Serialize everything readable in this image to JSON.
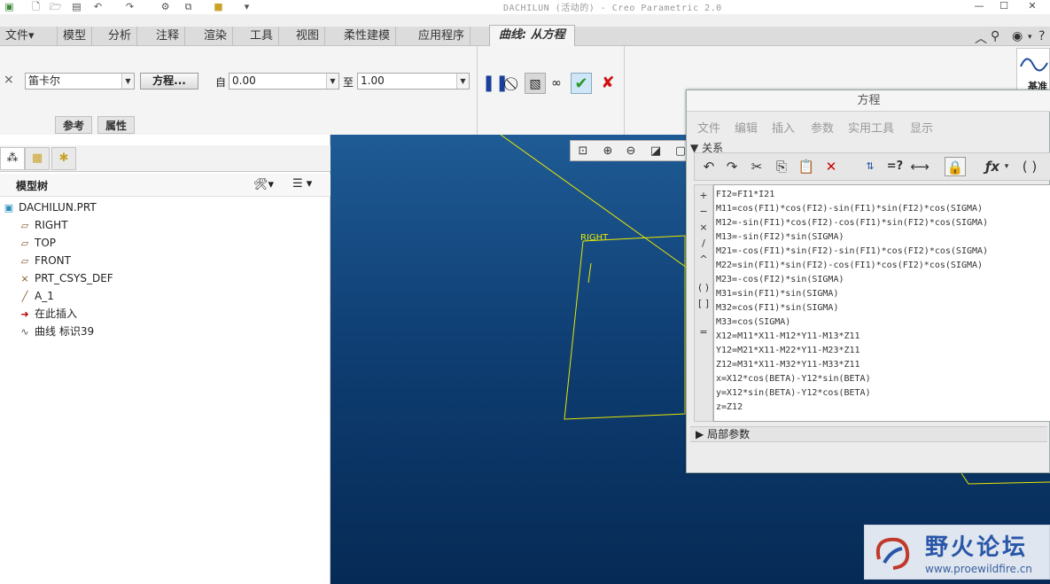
{
  "app": {
    "title": "DACHILUN (活动的) - Creo Parametric 2.0"
  },
  "menu": {
    "tabs": [
      "文件▾",
      "模型",
      "分析",
      "注释",
      "渲染",
      "工具",
      "视图",
      "柔性建模",
      "应用程序"
    ],
    "active_tab": "曲线: 从方程"
  },
  "ribbon": {
    "coord_system": "笛卡尔",
    "equation_button": "方程...",
    "from_label": "自",
    "from_value": "0.00",
    "to_label": "至",
    "to_value": "1.00",
    "subtabs": [
      "参考",
      "属性"
    ],
    "right_widget_label": "基准"
  },
  "model_tree": {
    "title": "模型树",
    "items": [
      {
        "icon": "part-icon",
        "label": "DACHILUN.PRT"
      },
      {
        "icon": "datum-plane-icon",
        "label": "RIGHT"
      },
      {
        "icon": "datum-plane-icon",
        "label": "TOP"
      },
      {
        "icon": "datum-plane-icon",
        "label": "FRONT"
      },
      {
        "icon": "csys-icon",
        "label": "PRT_CSYS_DEF"
      },
      {
        "icon": "axis-icon",
        "label": "A_1"
      },
      {
        "icon": "insert-arrow-icon",
        "label": "在此插入"
      },
      {
        "icon": "curve-icon",
        "label": "曲线 标识39"
      }
    ]
  },
  "graphics": {
    "plane_label": "RIGHT"
  },
  "equation_dialog": {
    "title": "方程",
    "menu": [
      "文件",
      "编辑",
      "插入",
      "参数",
      "实用工具",
      "显示"
    ],
    "section_relations": "关系",
    "operators": [
      "+",
      "−",
      "×",
      "/",
      "^",
      "( )",
      "[ ]",
      "="
    ],
    "equations": [
      "FI2=FI1*I21",
      "M11=cos(FI1)*cos(FI2)-sin(FI1)*sin(FI2)*cos(SIGMA)",
      "M12=-sin(FI1)*cos(FI2)-cos(FI1)*sin(FI2)*cos(SIGMA)",
      "M13=-sin(FI2)*sin(SIGMA)",
      "M21=-cos(FI1)*sin(FI2)-sin(FI1)*cos(FI2)*cos(SIGMA)",
      "M22=sin(FI1)*sin(FI2)-cos(FI1)*cos(FI2)*cos(SIGMA)",
      "M23=-cos(FI2)*sin(SIGMA)",
      "M31=sin(FI1)*sin(SIGMA)",
      "M32=cos(FI1)*sin(SIGMA)",
      "M33=cos(SIGMA)",
      "X12=M11*X11-M12*Y11-M13*Z11",
      "Y12=M21*X11-M22*Y11-M23*Z11",
      "Z12=M31*X11-M32*Y11-M33*Z11",
      "x=X12*cos(BETA)-Y12*sin(BETA)",
      "y=X12*sin(BETA)-Y12*cos(BETA)",
      "z=Z12"
    ],
    "section_local_params": "局部参数"
  },
  "watermark": {
    "title": "野火论坛",
    "url": "www.proewildfire.cn"
  },
  "colors": {
    "graphics_top": "#1f5b95",
    "graphics_bottom": "#062a55",
    "sketch_line": "#e8e800",
    "confirm_green": "#2a9a2a",
    "cancel_red": "#d01010"
  }
}
